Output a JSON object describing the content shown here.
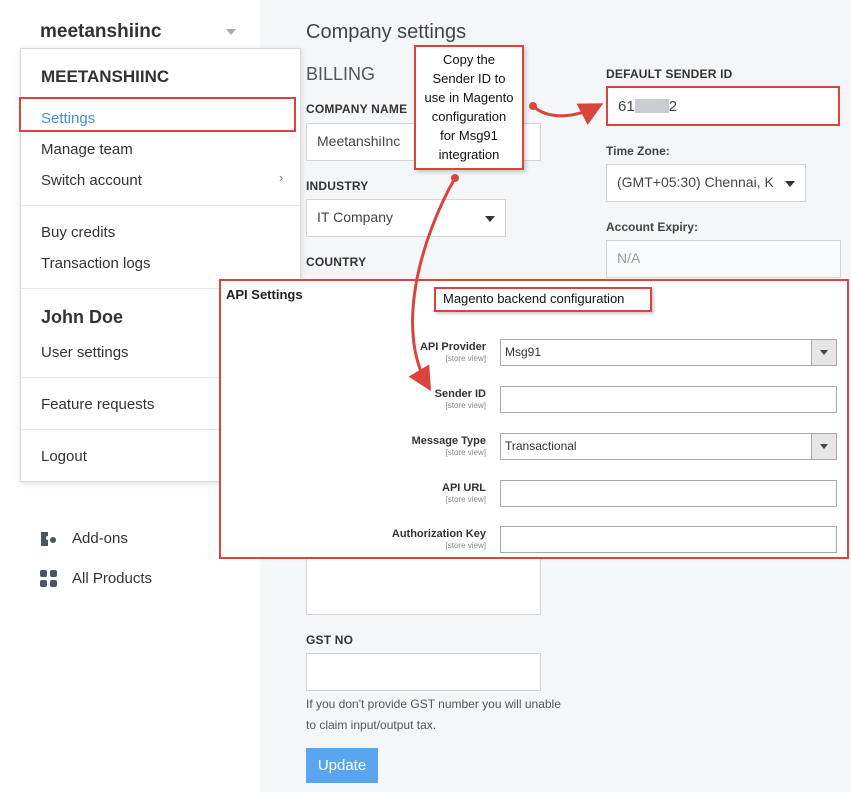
{
  "sidebar": {
    "workspace_name": "meetanshiinc",
    "dropdown": {
      "title": "MEETANSHIINC",
      "items": [
        "Settings",
        "Manage team",
        "Switch account"
      ],
      "billing_items": [
        "Buy credits",
        "Transaction logs"
      ],
      "user_name": "John Doe",
      "user_items": [
        "User settings"
      ],
      "feature_item": "Feature requests",
      "logout": "Logout"
    },
    "links": [
      {
        "label": "Add-ons",
        "icon": "addons-icon"
      },
      {
        "label": "All Products",
        "icon": "grid-icon"
      }
    ]
  },
  "main": {
    "title": "Company settings",
    "billing_title": "BILLING",
    "company_name_label": "COMPANY NAME",
    "company_name_value": "MeetanshiInc",
    "industry_label": "INDUSTRY",
    "industry_value": "IT Company",
    "country_label": "COUNTRY",
    "default_sender_label": "DEFAULT SENDER ID",
    "default_sender_prefix": "61",
    "default_sender_suffix": "2",
    "timezone_label": "Time Zone:",
    "timezone_value": "(GMT+05:30) Chennai, K",
    "expiry_label": "Account Expiry:",
    "expiry_value": "N/A",
    "gst_label": "GST NO",
    "gst_help_line1": "If you don't provide GST number you will unable",
    "gst_help_line2": "to claim input/output tax.",
    "update_button": "Update"
  },
  "annotation": {
    "note_lines": [
      "Copy the",
      "Sender ID to",
      "use in Magento",
      "configuration",
      "for Msg91",
      "integration"
    ],
    "backend_label": "Magento backend configuration"
  },
  "api_settings": {
    "title": "API Settings",
    "scope": "[store view]",
    "fields": [
      {
        "label": "API Provider",
        "value": "Msg91"
      },
      {
        "label": "Sender ID",
        "value": ""
      },
      {
        "label": "Message Type",
        "value": "Transactional"
      },
      {
        "label": "API URL",
        "value": ""
      },
      {
        "label": "Authorization Key",
        "value": ""
      }
    ]
  },
  "colors": {
    "highlight": "#d9453c",
    "accent": "#4a90e2",
    "button": "#5aa5ef"
  }
}
